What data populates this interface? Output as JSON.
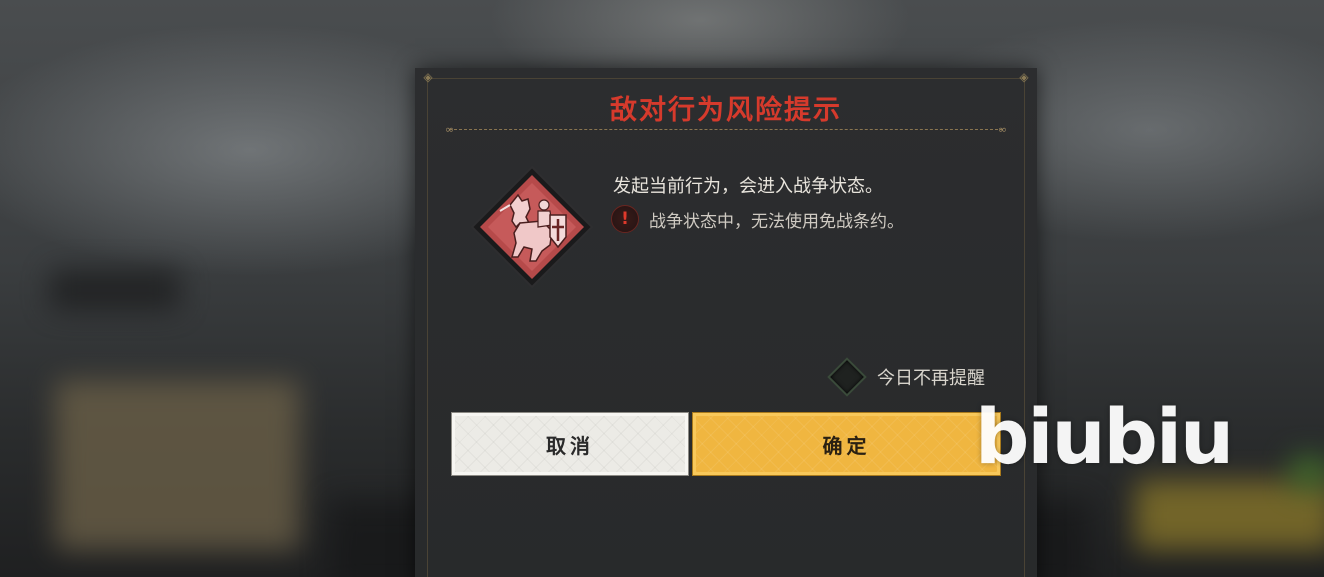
{
  "dialog": {
    "title": "敌对行为风险提示",
    "message": "发起当前行为，会进入战争状态。",
    "warning_text": "战争状态中，无法使用免战条约。",
    "warning_icon": "exclamation-icon",
    "emblem_icon": "knight-on-horse-icon",
    "remind_label": "今日不再提醒",
    "remind_checked": false,
    "cancel_label": "取消",
    "confirm_label": "确定"
  },
  "colors": {
    "title": "#d63a2c",
    "confirm_button": "#f0b640",
    "cancel_button": "#ecebe6",
    "panel": "#2c2d2f"
  },
  "watermark": {
    "text": "biubiu"
  }
}
